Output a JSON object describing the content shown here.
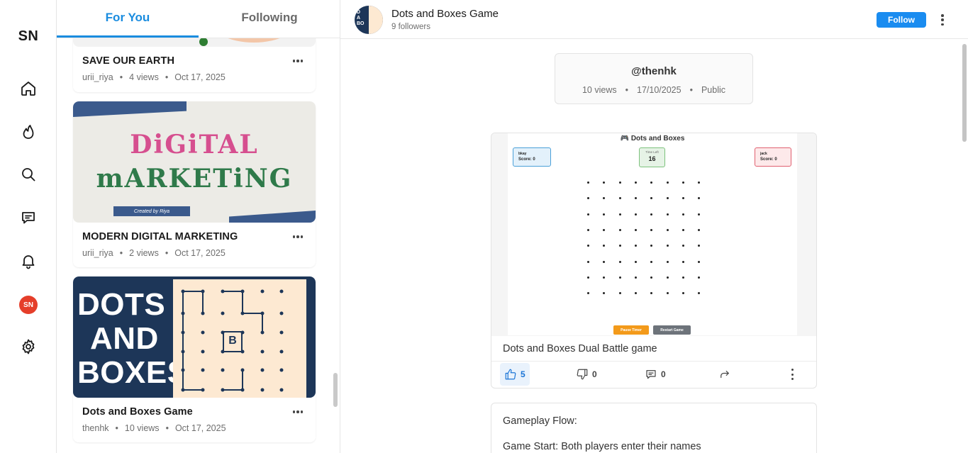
{
  "app": {
    "logo": "SN",
    "user_initials": "SN"
  },
  "rail": {
    "icons": [
      "home-icon",
      "flame-icon",
      "search-icon",
      "message-icon",
      "bell-icon",
      "avatar",
      "gear-icon"
    ]
  },
  "feed": {
    "tabs": [
      {
        "label": "For You",
        "active": true
      },
      {
        "label": "Following",
        "active": false
      }
    ],
    "cards": [
      {
        "title": "SAVE OUR EARTH",
        "author": "urii_riya",
        "views": "4 views",
        "date": "Oct 17, 2025"
      },
      {
        "title": "MODERN DIGITAL MARKETING",
        "author": "urii_riya",
        "views": "2 views",
        "date": "Oct 17, 2025",
        "thumb_text": [
          "DiGiTAL",
          "mARKETiNG",
          "Created by Riya"
        ]
      },
      {
        "title": "Dots and Boxes Game",
        "author": "thenhk",
        "views": "10 views",
        "date": "Oct 17, 2025",
        "thumb_text": [
          "DOTS",
          "AND",
          "BOXES",
          "B"
        ]
      }
    ]
  },
  "detail": {
    "header": {
      "title": "Dots and Boxes Game",
      "followers": "9 followers",
      "follow_label": "Follow"
    },
    "info": {
      "user": "@thenhk",
      "views": "10 views",
      "date": "17/10/2025",
      "visibility": "Public"
    },
    "post": {
      "game": {
        "title": "🎮 Dots and Boxes",
        "player1": {
          "name": "bkay",
          "score": "Score: 0"
        },
        "timer": {
          "label": "Time Left",
          "value": "16"
        },
        "player2": {
          "name": "jack",
          "score": "Score: 0"
        },
        "pause_label": "Pause Timer",
        "restart_label": "Restart Game"
      },
      "caption": "Dots and Boxes Dual Battle game",
      "likes": "5",
      "dislikes": "0",
      "comments": "0"
    },
    "description": {
      "heading": "Gameplay Flow:",
      "line1": "Game Start: Both players enter their names"
    }
  },
  "colors": {
    "accent": "#1a8cdf",
    "follow": "#1a8cf0",
    "avatar": "#e53e2a",
    "navy": "#1d3658",
    "cream": "#fde9d2"
  }
}
